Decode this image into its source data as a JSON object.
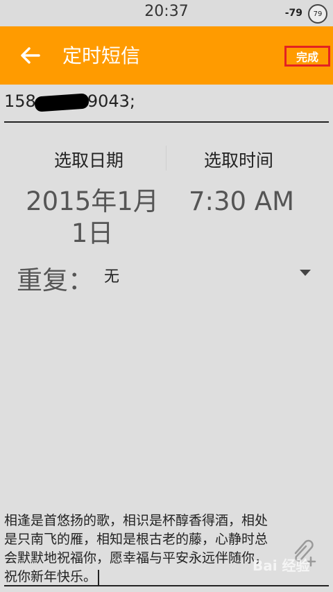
{
  "status": {
    "time": "20:37",
    "signal": "-79",
    "battery": "79"
  },
  "appbar": {
    "title": "定时短信",
    "done_label": "完成"
  },
  "recipient": {
    "prefix": "158",
    "suffix": "9043;"
  },
  "schedule": {
    "date_header": "选取日期",
    "time_header": "选取时间",
    "date_value": "2015年1月1日",
    "time_value": "7:30 AM"
  },
  "repeat": {
    "label": "重复：",
    "value": "无"
  },
  "message": {
    "text": "相逢是首悠扬的歌，相识是杯醇香得酒，相处是只南飞的雁，相知是根古老的藤，心静时总会默默地祝福你，愿幸福与平安永远伴随你，祝你新年快乐。"
  },
  "watermark": {
    "text": "Bai 经验"
  },
  "icons": {
    "back": "arrow-left-icon",
    "attach": "paperclip-plus-icon",
    "dropdown": "triangle-down-icon"
  }
}
